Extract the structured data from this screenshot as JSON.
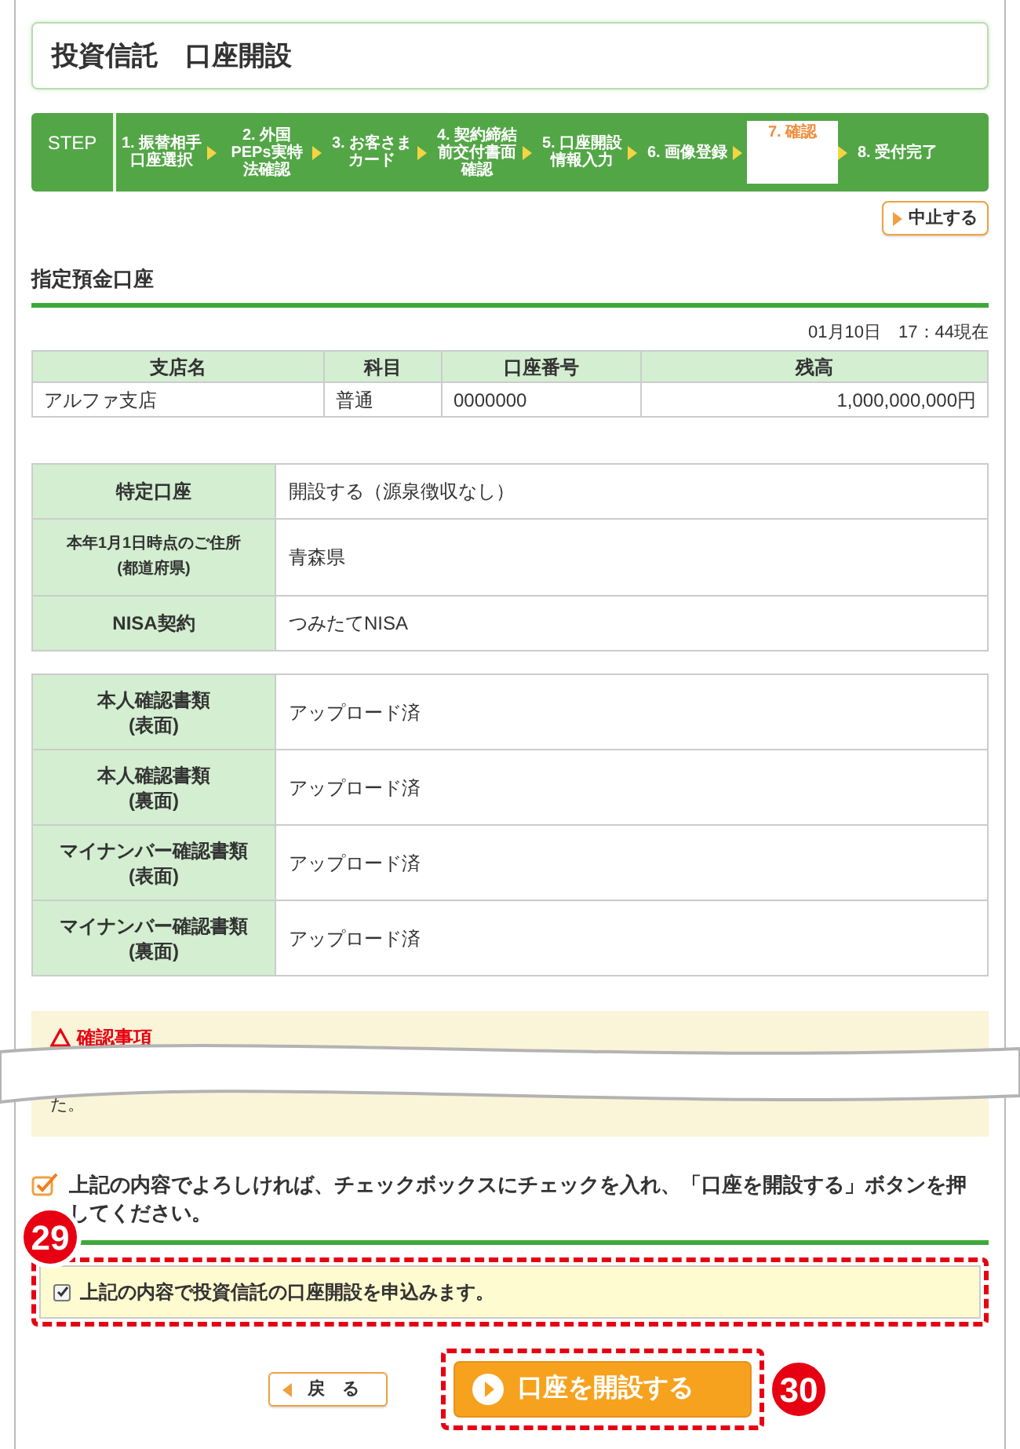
{
  "page_title": "投資信託　口座開設",
  "steps": {
    "label": "STEP",
    "items": [
      {
        "label": "1. 振替相手口座選択",
        "selected": false
      },
      {
        "label": "2. 外国PEPs実特法確認",
        "selected": false
      },
      {
        "label": "3. お客さまカード",
        "selected": false
      },
      {
        "label": "4. 契約締結前交付書面確認",
        "selected": false
      },
      {
        "label": "5. 口座開設情報入力",
        "selected": false
      },
      {
        "label": "6. 画像登録",
        "selected": false
      },
      {
        "label": "7. 確認",
        "selected": true
      },
      {
        "label": "8. 受付完了",
        "selected": false
      }
    ]
  },
  "cancel_button": "中止する",
  "section_title": "指定預金口座",
  "timestamp": "01月10日　17：44現在",
  "account_table": {
    "columns": [
      "支店名",
      "科目",
      "口座番号",
      "残高"
    ],
    "rows": [
      [
        "アルファ支店",
        "普通",
        "0000000",
        "1,000,000,000円"
      ]
    ]
  },
  "details": [
    {
      "label": "特定口座",
      "value": "開設する（源泉徴収なし）"
    },
    {
      "label": "本年1月1日時点のご住所",
      "sublabel": "(都道府県)",
      "value": "青森県"
    },
    {
      "label": "NISA契約",
      "value": "つみたてNISA"
    }
  ],
  "documents": [
    {
      "label": "本人確認書類",
      "sublabel": "(表面)",
      "value": "アップロード済"
    },
    {
      "label": "本人確認書類",
      "sublabel": "(裏面)",
      "value": "アップロード済"
    },
    {
      "label": "マイナンバー確認書類",
      "sublabel": "(表面)",
      "value": "アップロード済"
    },
    {
      "label": "マイナンバー確認書類",
      "sublabel": "(裏面)",
      "value": "アップロード済"
    }
  ],
  "notice": {
    "title": "確認事項",
    "tail": "た。"
  },
  "instruction": "上記の内容でよろしければ、チェックボックスにチェックを入れ、「口座を開設する」ボタンを押してください。",
  "agreement": {
    "label": "上記の内容で投資信託の口座開設を申込みます。",
    "checked": true
  },
  "back_button": "戻　る",
  "submit_button": "口座を開設する",
  "annotations": [
    "29",
    "30"
  ]
}
